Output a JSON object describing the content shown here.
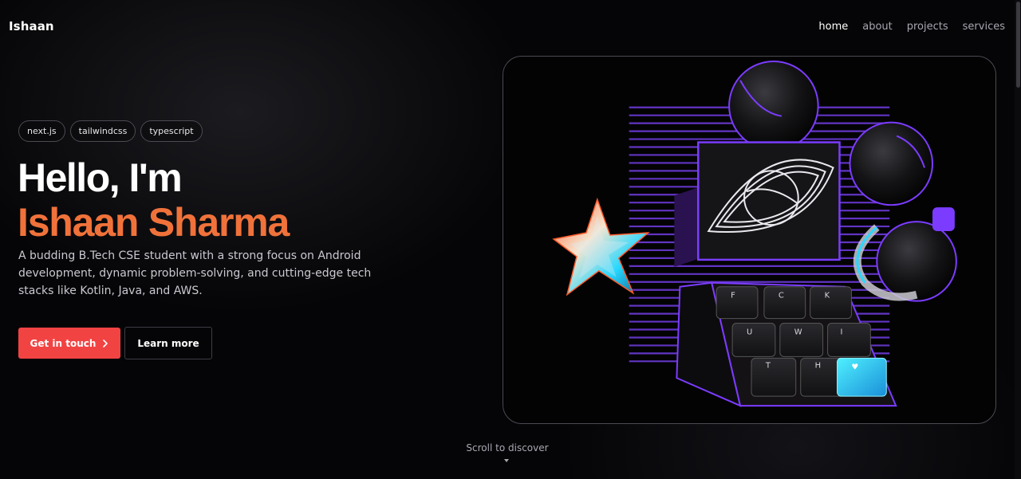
{
  "header": {
    "brand": "Ishaan",
    "nav": [
      {
        "label": "home",
        "active": true
      },
      {
        "label": "about",
        "active": false
      },
      {
        "label": "projects",
        "active": false
      },
      {
        "label": "services",
        "active": false
      }
    ]
  },
  "hero": {
    "tags": [
      "next.js",
      "tailwindcss",
      "typescript"
    ],
    "greeting": "Hello, I'm",
    "name": "Ishaan Sharma",
    "description": "A budding B.Tech CSE student with a strong focus on Android development, dynamic problem-solving, and cutting-edge tech stacks like Kotlin, Java, and AWS.",
    "primary_button": "Get in touch",
    "secondary_button": "Learn more",
    "illustration": {
      "keycaps": [
        "F",
        "C",
        "K",
        "U",
        "W",
        "I",
        "T",
        "H",
        "♥"
      ]
    }
  },
  "scroll_hint": "Scroll to discover",
  "colors": {
    "accent": "#f0723a",
    "button": "#f24343",
    "background": "#050507",
    "purple": "#7b3cff",
    "cyan": "#2ee6ff"
  }
}
